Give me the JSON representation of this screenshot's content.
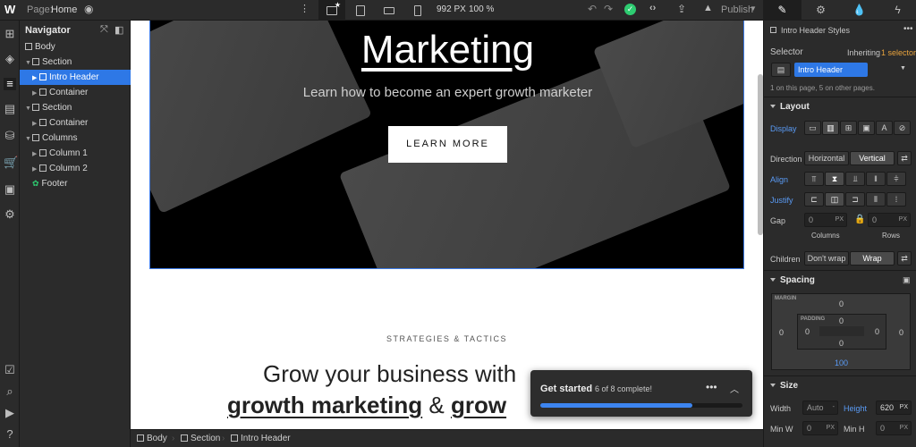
{
  "topbar": {
    "logo": "W",
    "page_label": "Page:",
    "page_name": "Home",
    "width": "992 PX",
    "zoom": "100 %",
    "publish": "Publish"
  },
  "navigator": {
    "title": "Navigator",
    "items": [
      {
        "label": "Body",
        "depth": 0
      },
      {
        "label": "Section",
        "depth": 1
      },
      {
        "label": "Intro Header",
        "depth": 2,
        "selected": true
      },
      {
        "label": "Container",
        "depth": 2
      },
      {
        "label": "Section",
        "depth": 1
      },
      {
        "label": "Container",
        "depth": 2
      },
      {
        "label": "Columns",
        "depth": 1
      },
      {
        "label": "Column 1",
        "depth": 2
      },
      {
        "label": "Column 2",
        "depth": 2
      },
      {
        "label": "Footer",
        "depth": 1
      }
    ]
  },
  "canvas": {
    "hero_title": "Marketing",
    "hero_subtitle": "Learn how to become an expert growth marketer",
    "hero_button": "LEARN MORE",
    "eyebrow": "STRATEGIES & TACTICS",
    "heading_line1": "Grow your business with",
    "heading_line2_a": "growth marketing",
    "heading_line2_b": "&",
    "heading_line2_c": "grow"
  },
  "breadcrumbs": [
    "Body",
    "Section",
    "Intro Header"
  ],
  "get_started": {
    "title": "Get started",
    "progress_text": "6 of 8 complete!",
    "progress": 0.75
  },
  "panel": {
    "style_title": "Intro Header Styles",
    "selector_label": "Selector",
    "inheriting": "Inheriting",
    "inheriting_count": "1 selector",
    "selector_value": "Intro Header",
    "pages_note": "1 on this page, 5 on other pages.",
    "layout": {
      "title": "Layout",
      "display_label": "Display",
      "direction_label": "Direction",
      "direction_horizontal": "Horizontal",
      "direction_vertical": "Vertical",
      "align_label": "Align",
      "justify_label": "Justify",
      "gap_label": "Gap",
      "gap_col_value": "0",
      "gap_row_value": "0",
      "unit_px": "PX",
      "columns_label": "Columns",
      "rows_label": "Rows",
      "children_label": "Children",
      "children_nowrap": "Don't wrap",
      "children_wrap": "Wrap"
    },
    "spacing": {
      "title": "Spacing",
      "margin_label": "MARGIN",
      "padding_label": "PADDING",
      "margin_top": "0",
      "margin_left": "0",
      "margin_right": "0",
      "margin_bottom": "100",
      "padding_top": "0",
      "padding_left": "0",
      "padding_right": "0",
      "padding_bottom": "0"
    },
    "size": {
      "title": "Size",
      "width_label": "Width",
      "width_value": "Auto",
      "height_label": "Height",
      "height_value": "620",
      "height_unit": "PX",
      "minw_label": "Min W",
      "minw_value": "0",
      "minh_label": "Min H",
      "minh_value": "0"
    }
  },
  "colors": {
    "accent": "#2e78e6",
    "success": "#2ecc71",
    "panel_bg": "#2b2b2b",
    "hero_bg": "#000000"
  }
}
